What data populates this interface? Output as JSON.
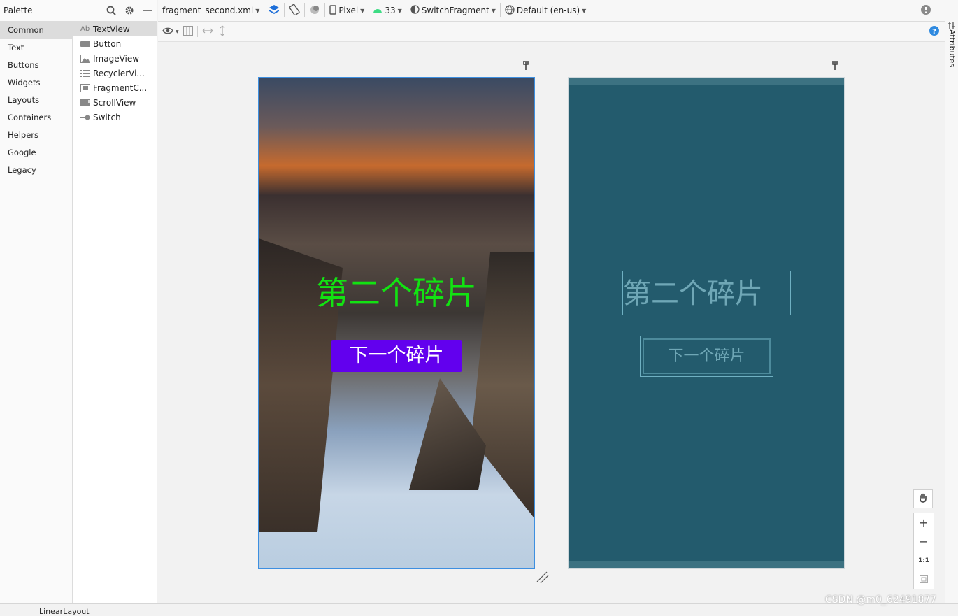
{
  "palette": {
    "title": "Palette",
    "categories": [
      "Common",
      "Text",
      "Buttons",
      "Widgets",
      "Layouts",
      "Containers",
      "Helpers",
      "Google",
      "Legacy"
    ],
    "selected_category": "Common",
    "widgets": [
      {
        "label": "TextView",
        "icon": "Ab"
      },
      {
        "label": "Button",
        "icon": "button-icon"
      },
      {
        "label": "ImageView",
        "icon": "image-icon"
      },
      {
        "label": "RecyclerVi...",
        "icon": "list-icon"
      },
      {
        "label": "FragmentC...",
        "icon": "fragment-icon"
      },
      {
        "label": "ScrollView",
        "icon": "scroll-icon"
      },
      {
        "label": "Switch",
        "icon": "switch-icon"
      }
    ]
  },
  "toolbar": {
    "file": "fragment_second.xml",
    "device": "Pixel",
    "api": "33",
    "fragment": "SwitchFragment",
    "locale": "Default (en-us)"
  },
  "attributes_label": "Attributes",
  "preview": {
    "title": "第二个碎片",
    "button": "下一个碎片"
  },
  "colors": {
    "title_green": "#12e312",
    "button_purple": "#6200ee",
    "blueprint_bg": "#235b6d"
  },
  "status": {
    "component": "LinearLayout"
  },
  "watermark": "CSDN @m0_62491877"
}
